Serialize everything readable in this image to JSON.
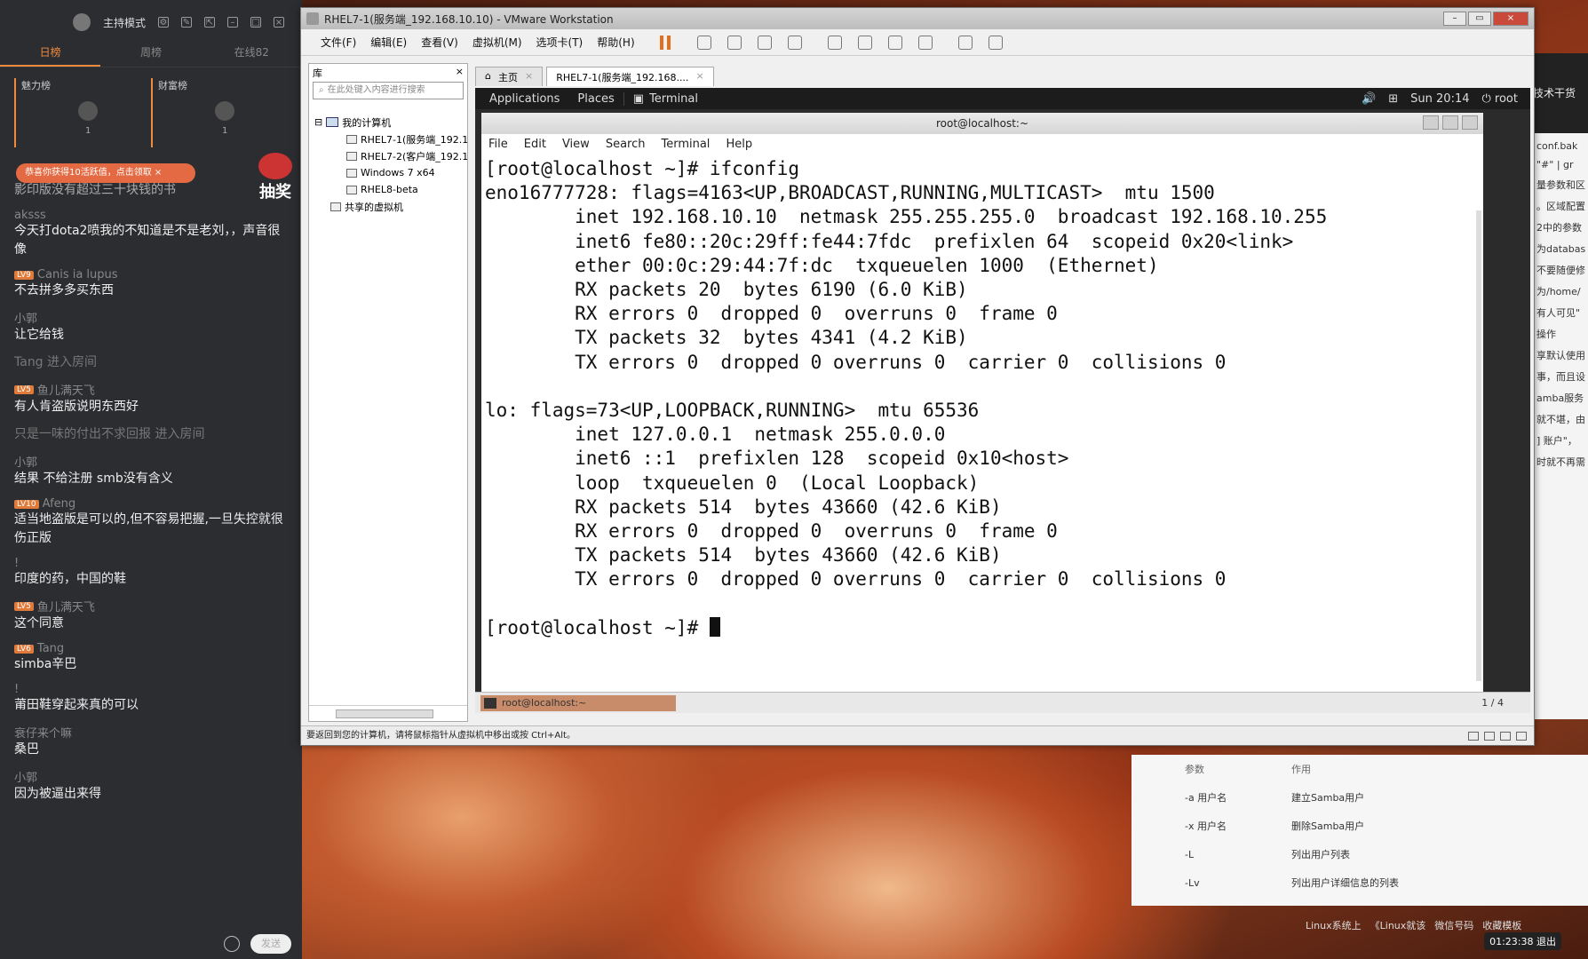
{
  "chat": {
    "mode": "主持模式",
    "tabs": [
      "日榜",
      "周榜",
      "在线82"
    ],
    "rank_left": "魅力榜",
    "rank_right": "财富榜",
    "rank_left_num": "1",
    "rank_right_num": "1",
    "promo": "恭喜你获得10活跃值，点击领取",
    "lottery": "抽奖",
    "partial_top": "影印版没有超过三十块钱的书",
    "messages": [
      {
        "user": "aksss",
        "lv": "",
        "text": "今天打dota2喷我的不知道是不是老刘，，声音很像"
      },
      {
        "user": "Canis ia lupus",
        "lv": "LV9",
        "text": "不去拼多多买东西"
      },
      {
        "user": "小郭",
        "lv": "",
        "text": "让它给钱"
      },
      {
        "user": "",
        "lv": "",
        "text": "Tang 进入房间",
        "sys": true
      },
      {
        "user": "鱼儿满天飞",
        "lv": "LV5",
        "text": "有人肯盗版说明东西好"
      },
      {
        "user": "",
        "lv": "",
        "text": "只是一味的付出不求回报 进入房间",
        "sys": true
      },
      {
        "user": "小郭",
        "lv": "",
        "text": "结果 不给注册 smb没有含义"
      },
      {
        "user": "Afeng",
        "lv": "LV10",
        "text": "适当地盗版是可以的,但不容易把握,一旦失控就很伤正版"
      },
      {
        "user": "!",
        "lv": "",
        "text": "印度的药，中国的鞋"
      },
      {
        "user": "鱼儿满天飞",
        "lv": "LV5",
        "text": "这个同意"
      },
      {
        "user": "Tang",
        "lv": "LV6",
        "text": "simba辛巴"
      },
      {
        "user": "!",
        "lv": "",
        "text": "莆田鞋穿起来真的可以"
      },
      {
        "user": "衰仔来个嘛",
        "lv": "",
        "text": "桑巴"
      },
      {
        "user": "小郭",
        "lv": "",
        "text": "因为被逼出来得"
      }
    ],
    "send": "发送"
  },
  "vmware": {
    "title": "RHEL7-1(服务端_192.168.10.10) - VMware Workstation",
    "menu": [
      "文件(F)",
      "编辑(E)",
      "查看(V)",
      "虚拟机(M)",
      "选项卡(T)",
      "帮助(H)"
    ],
    "library": {
      "header": "库",
      "search_placeholder": "在此处键入内容进行搜索",
      "root": "我的计算机",
      "vms": [
        "RHEL7-1(服务端_192.1",
        "RHEL7-2(客户端_192.1",
        "Windows 7 x64",
        "RHEL8-beta"
      ],
      "shared": "共享的虚拟机"
    },
    "tabs": [
      "主页",
      "RHEL7-1(服务端_192.168...."
    ],
    "status": "要返回到您的计算机，请将鼠标指针从虚拟机中移出或按 Ctrl+Alt。"
  },
  "guest": {
    "panel": {
      "applications": "Applications",
      "places": "Places",
      "terminal": "Terminal",
      "clock": "Sun 20:14",
      "user": "root"
    },
    "terminal": {
      "title": "root@localhost:~",
      "menu": [
        "File",
        "Edit",
        "View",
        "Search",
        "Terminal",
        "Help"
      ],
      "lines": [
        "[root@localhost ~]# ifconfig",
        "eno16777728: flags=4163<UP,BROADCAST,RUNNING,MULTICAST>  mtu 1500",
        "        inet 192.168.10.10  netmask 255.255.255.0  broadcast 192.168.10.255",
        "        inet6 fe80::20c:29ff:fe44:7fdc  prefixlen 64  scopeid 0x20<link>",
        "        ether 00:0c:29:44:7f:dc  txqueuelen 1000  (Ethernet)",
        "        RX packets 20  bytes 6190 (6.0 KiB)",
        "        RX errors 0  dropped 0  overruns 0  frame 0",
        "        TX packets 32  bytes 4341 (4.2 KiB)",
        "        TX errors 0  dropped 0 overruns 0  carrier 0  collisions 0",
        "",
        "lo: flags=73<UP,LOOPBACK,RUNNING>  mtu 65536",
        "        inet 127.0.0.1  netmask 255.0.0.0",
        "        inet6 ::1  prefixlen 128  scopeid 0x10<host>",
        "        loop  txqueuelen 0  (Local Loopback)",
        "        RX packets 514  bytes 43660 (42.6 KiB)",
        "        RX errors 0  dropped 0  overruns 0  frame 0",
        "        TX packets 514  bytes 43660 (42.6 KiB)",
        "        TX errors 0  dropped 0 overruns 0  carrier 0  collisions 0",
        "",
        "[root@localhost ~]# "
      ]
    },
    "taskbar": {
      "task": "root@localhost:~",
      "pages": "1 / 4"
    }
  },
  "background": {
    "doc_header": "技术干货",
    "doc_snippets": [
      "conf.bak",
      "\"#\" | gr",
      "量参数和区",
      "。区域配置",
      "2中的参数",
      "为databas",
      "不要随便修",
      "为/home/",
      "有人可见\"",
      "操作",
      "享默认使用",
      "事，而且设",
      "amba服务",
      "就不堪，由",
      "] 账户\"，",
      "时就不再需"
    ],
    "table_header": [
      "参数",
      "作用"
    ],
    "table_rows": [
      [
        "-a 用户名",
        "建立Samba用户"
      ],
      [
        "-x 用户名",
        "删除Samba用户"
      ],
      [
        "-L",
        "列出用户列表"
      ],
      [
        "-Lv",
        "列出用户详细信息的列表"
      ]
    ],
    "taskbar": [
      "Linux系统上",
      "《Linux就该",
      "微信号码",
      "收藏模板"
    ],
    "timer": "01:23:38",
    "exit": "退出"
  }
}
